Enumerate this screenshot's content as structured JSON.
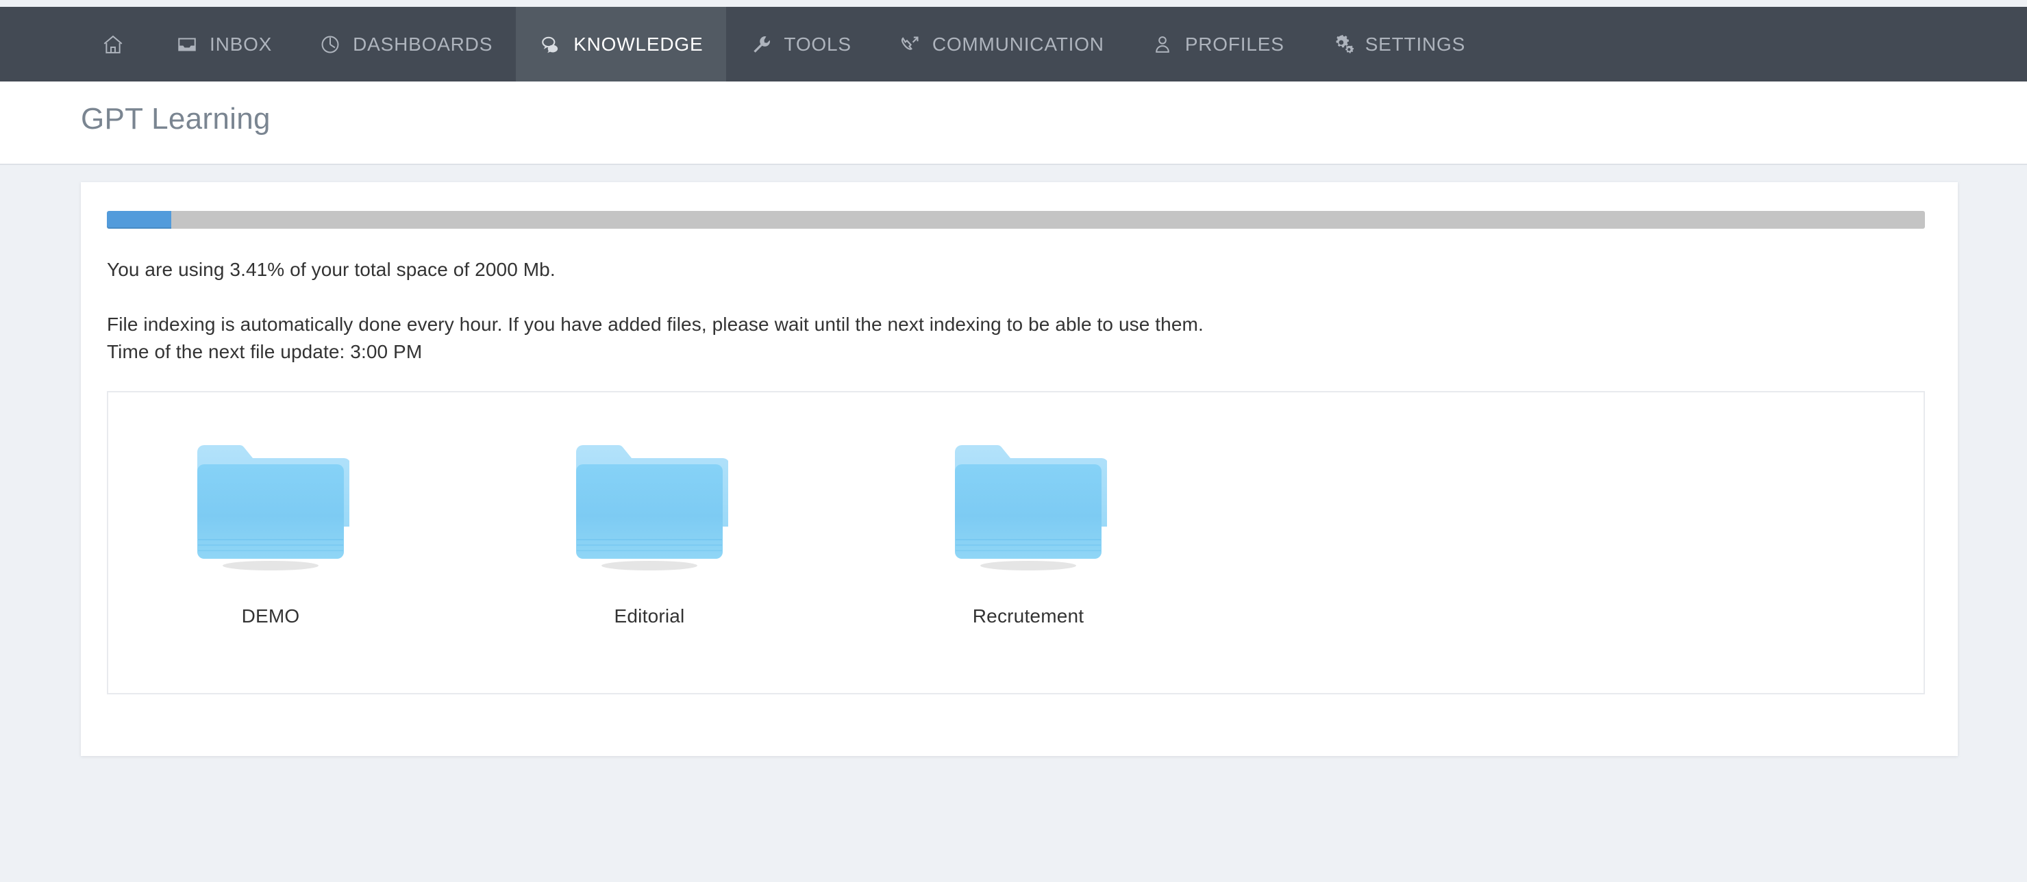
{
  "nav": {
    "items": [
      {
        "label": "",
        "icon": "home-icon",
        "name": "nav-home",
        "active": false
      },
      {
        "label": "INBOX",
        "icon": "inbox-icon",
        "name": "nav-inbox",
        "active": false
      },
      {
        "label": "DASHBOARDS",
        "icon": "dashboard-icon",
        "name": "nav-dashboards",
        "active": false
      },
      {
        "label": "KNOWLEDGE",
        "icon": "chat-bubbles-icon",
        "name": "nav-knowledge",
        "active": true
      },
      {
        "label": "TOOLS",
        "icon": "wrench-icon",
        "name": "nav-tools",
        "active": false
      },
      {
        "label": "COMMUNICATION",
        "icon": "phone-icon",
        "name": "nav-communication",
        "active": false
      },
      {
        "label": "PROFILES",
        "icon": "user-icon",
        "name": "nav-profiles",
        "active": false
      },
      {
        "label": "SETTINGS",
        "icon": "gears-icon",
        "name": "nav-settings",
        "active": false
      }
    ],
    "background_color": "#434a54",
    "active_background_color": "#525a63",
    "inactive_text_color": "#aeb4bd",
    "active_text_color": "#ffffff"
  },
  "header": {
    "title": "GPT Learning"
  },
  "storage": {
    "percent_used": 3.41,
    "total_space": "2000 Mb",
    "usage_text": "You are using 3.41% of your total space of 2000 Mb.",
    "progress_fill_color": "#529bdb",
    "progress_track_color": "#c4c4c4",
    "progress_width_percent": "3.41%"
  },
  "indexing": {
    "info_text": "File indexing is automatically done every hour. If you have added files, please wait until the next indexing to be able to use them.",
    "next_update_text": "Time of the next file update: 3:00 PM",
    "next_update_time": "3:00 PM"
  },
  "folders": [
    {
      "label": "DEMO",
      "icon": "folder-icon"
    },
    {
      "label": "Editorial",
      "icon": "folder-icon"
    },
    {
      "label": "Recrutement",
      "icon": "folder-icon"
    }
  ],
  "colors": {
    "page_background": "#eef1f5",
    "card_background": "#ffffff",
    "title_text": "#7a8591",
    "body_text": "#333333",
    "panel_border": "#e8eaee",
    "folder_front": "#7ecdf5",
    "folder_back": "#a5dcf8"
  }
}
